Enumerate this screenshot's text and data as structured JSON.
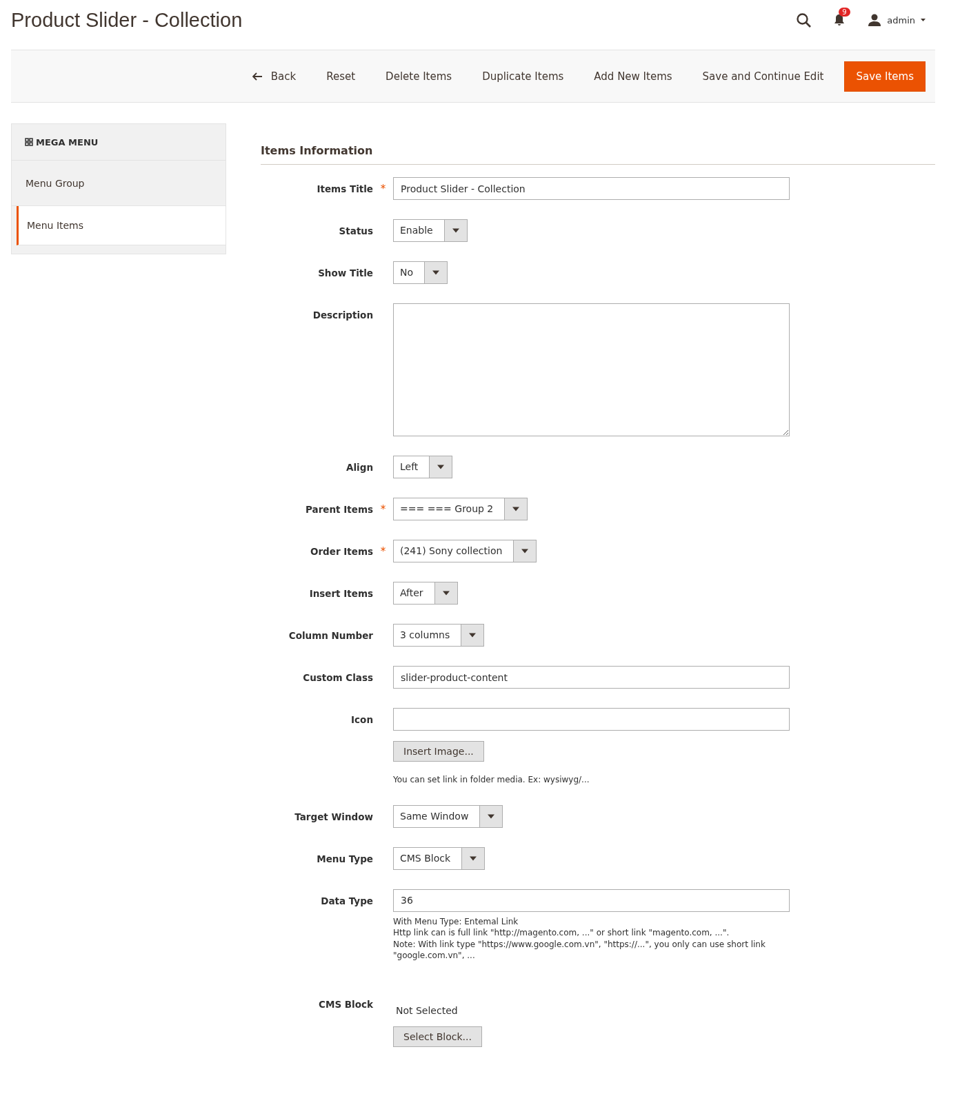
{
  "header": {
    "title": "Product Slider - Collection",
    "notification_count": "9",
    "user": "admin"
  },
  "toolbar": {
    "back": "Back",
    "actions": [
      "Reset",
      "Delete Items",
      "Duplicate Items",
      "Add New Items",
      "Save and Continue Edit"
    ],
    "primary": "Save Items"
  },
  "sidebar": {
    "title": "MEGA MENU",
    "items": [
      {
        "label": "Menu Group",
        "selected": false
      },
      {
        "label": "Menu Items",
        "selected": true
      }
    ]
  },
  "section": {
    "title": "Items Information"
  },
  "fields": [
    {
      "kind": "text",
      "label": "Items Title",
      "required_mark": "*",
      "value": "Product Slider - Collection"
    },
    {
      "kind": "select",
      "label": "Status",
      "value": "Enable"
    },
    {
      "kind": "select",
      "label": "Show Title",
      "value": "No"
    },
    {
      "kind": "textarea",
      "label": "Description"
    },
    {
      "kind": "select",
      "label": "Align",
      "value": "Left"
    },
    {
      "kind": "select",
      "label": "Parent Items",
      "required_mark": "*",
      "value": "=== === Group 2"
    },
    {
      "kind": "select",
      "label": "Order Items",
      "required_mark": "*",
      "value": "(241) Sony collection"
    },
    {
      "kind": "select",
      "label": "Insert Items",
      "value": "After"
    },
    {
      "kind": "select",
      "label": "Column Number",
      "value": "3 columns"
    },
    {
      "kind": "text",
      "label": "Custom Class",
      "value": "slider-product-content"
    },
    {
      "kind": "image",
      "label": "Icon",
      "button": "Insert Image...",
      "note_lines": [
        "You can set link in folder media. Ex: wysiwyg/..."
      ]
    },
    {
      "kind": "select",
      "label": "Target Window",
      "value": "Same Window"
    },
    {
      "kind": "select",
      "label": "Menu Type",
      "value": "CMS Block"
    },
    {
      "kind": "text",
      "label": "Data Type",
      "value": "36",
      "note_lines": [
        "With Menu Type: Entemal Link",
        "Http link can is full link \"http://magento.com, ...\" or short link \"magento.com, ...\".",
        "Note: With link type \"https://www.google.com.vn\", \"https://...\", you only can use short link \"google.com.vn\", ..."
      ]
    },
    {
      "kind": "cms_block",
      "label": "CMS Block",
      "value": "Not Selected",
      "button": "Select Block..."
    }
  ]
}
